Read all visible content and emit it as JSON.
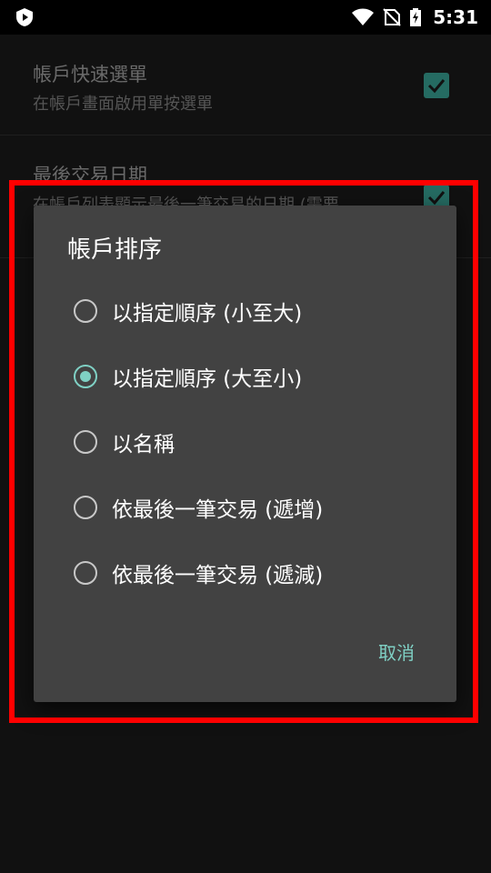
{
  "status_bar": {
    "time": "5:31",
    "icons": [
      "wifi-icon",
      "no-sim-icon",
      "battery-charging-icon"
    ]
  },
  "settings": {
    "items": [
      {
        "title": "帳戶快速選單",
        "summary": "在帳戶畫面啟用單按選單",
        "checked": true
      },
      {
        "title": "最後交易日期",
        "summary": "在帳戶列表顯示最後一筆交易的日期 (需要",
        "checked": true
      }
    ]
  },
  "dialog": {
    "title": "帳戶排序",
    "options": [
      {
        "label": "以指定順序 (小至大)",
        "selected": false
      },
      {
        "label": "以指定順序 (大至小)",
        "selected": true
      },
      {
        "label": "以名稱",
        "selected": false
      },
      {
        "label": "依最後一筆交易 (遞增)",
        "selected": false
      },
      {
        "label": "依最後一筆交易 (遞減)",
        "selected": false
      }
    ],
    "cancel_label": "取消"
  },
  "colors": {
    "accent": "#7fd0c4",
    "highlight_frame": "#ff0000",
    "dialog_bg": "#424242"
  }
}
